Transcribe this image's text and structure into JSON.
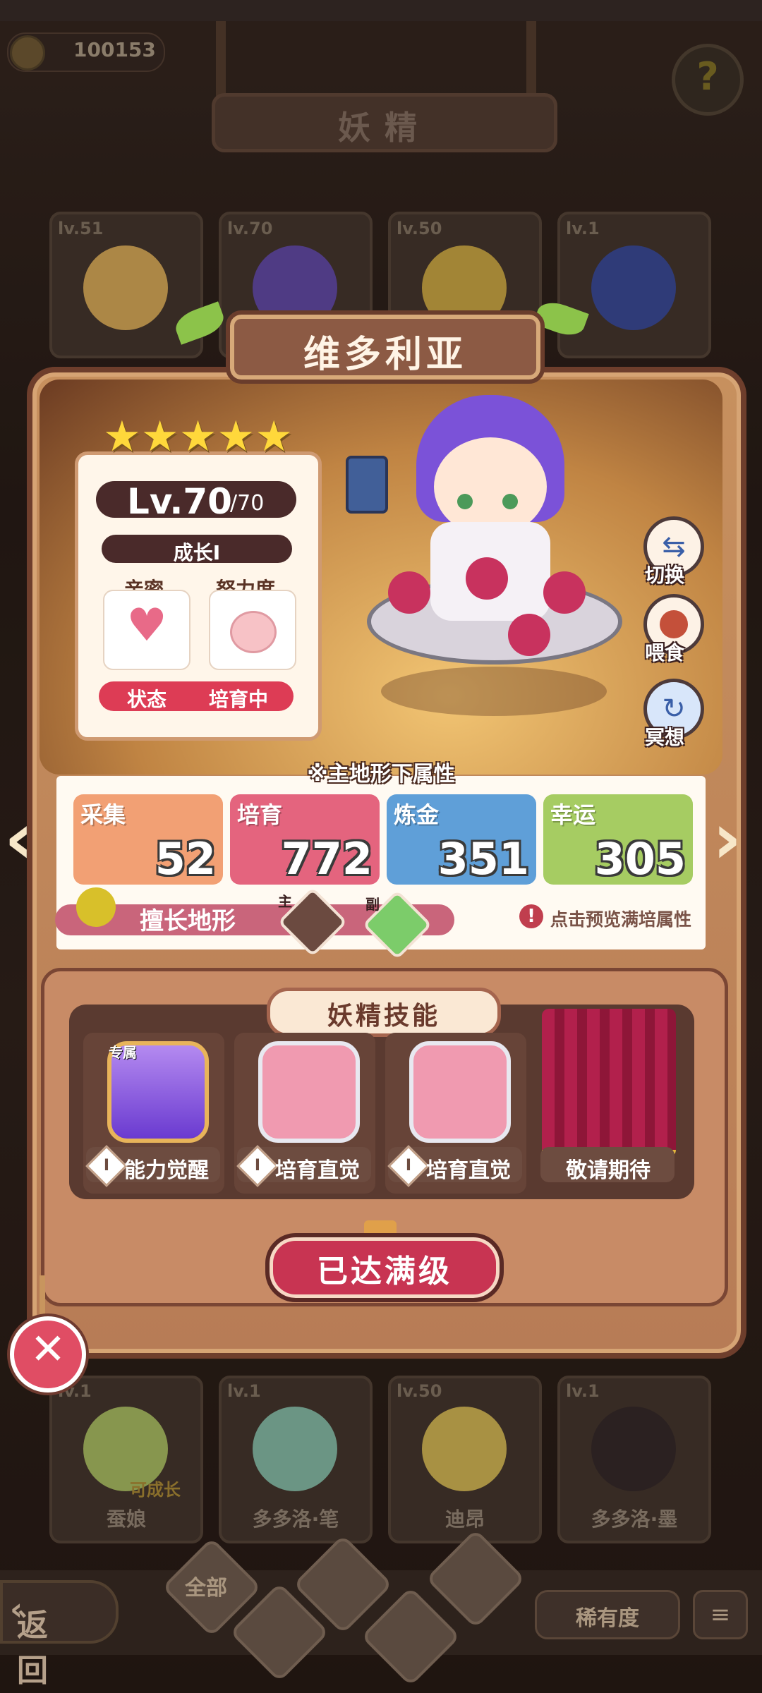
{
  "currency": {
    "value": "100153",
    "icon": "coin-icon"
  },
  "page_title": "妖精",
  "help_icon": "question-mark-icon",
  "background_cards": [
    {
      "level": "lv.51",
      "name": ""
    },
    {
      "level": "lv.70",
      "name": ""
    },
    {
      "level": "lv.50",
      "name": ""
    },
    {
      "level": "lv.1",
      "name": ""
    }
  ],
  "bottom_cards": [
    {
      "level": "lv.1",
      "name": "蚕娘",
      "tag": "可成长"
    },
    {
      "level": "lv.1",
      "name": "多多洛·笔",
      "tag": ""
    },
    {
      "level": "lv.50",
      "name": "迪昂",
      "tag": ""
    },
    {
      "level": "lv.1",
      "name": "多多洛·墨",
      "tag": ""
    }
  ],
  "fairy": {
    "name": "维多利亚",
    "stars": 5,
    "level": "Lv.70",
    "level_max": "/70",
    "growth": "成长I",
    "intimacy_label": "亲密",
    "effort_label": "努力度",
    "status_label": "状态",
    "status_value": "培育中"
  },
  "side_actions": [
    {
      "label": "切换",
      "icon": "switch-icon"
    },
    {
      "label": "喂食",
      "icon": "meat-icon"
    },
    {
      "label": "冥想",
      "icon": "meditate-icon"
    }
  ],
  "attributes": {
    "title": "※主地形下属性",
    "items": [
      {
        "name": "采集",
        "value": "52",
        "color": "#f2a074"
      },
      {
        "name": "培育",
        "value": "772",
        "color": "#e4647e"
      },
      {
        "name": "炼金",
        "value": "351",
        "color": "#5f9fd8"
      },
      {
        "name": "幸运",
        "value": "305",
        "color": "#a6cc62"
      }
    ],
    "terrain_label": "擅长地形",
    "main_tag": "主",
    "sub_tag": "副",
    "preview_hint": "点击预览满培属性"
  },
  "skills": {
    "title": "妖精技能",
    "items": [
      {
        "label": "能力觉醒",
        "badge": "专属",
        "info": "I",
        "icon": "awakening-icon"
      },
      {
        "label": "培育直觉",
        "badge": "",
        "info": "I",
        "icon": "watering-can-icon"
      },
      {
        "label": "培育直觉",
        "badge": "",
        "info": "I",
        "icon": "watering-can-icon"
      },
      {
        "label": "敬请期待",
        "badge": "",
        "info": "",
        "icon": "curtain-icon"
      }
    ]
  },
  "max_level_button": "已达满级",
  "bottom_nav": {
    "back": "返回",
    "all_filter": "全部",
    "rarity": "稀有度"
  }
}
